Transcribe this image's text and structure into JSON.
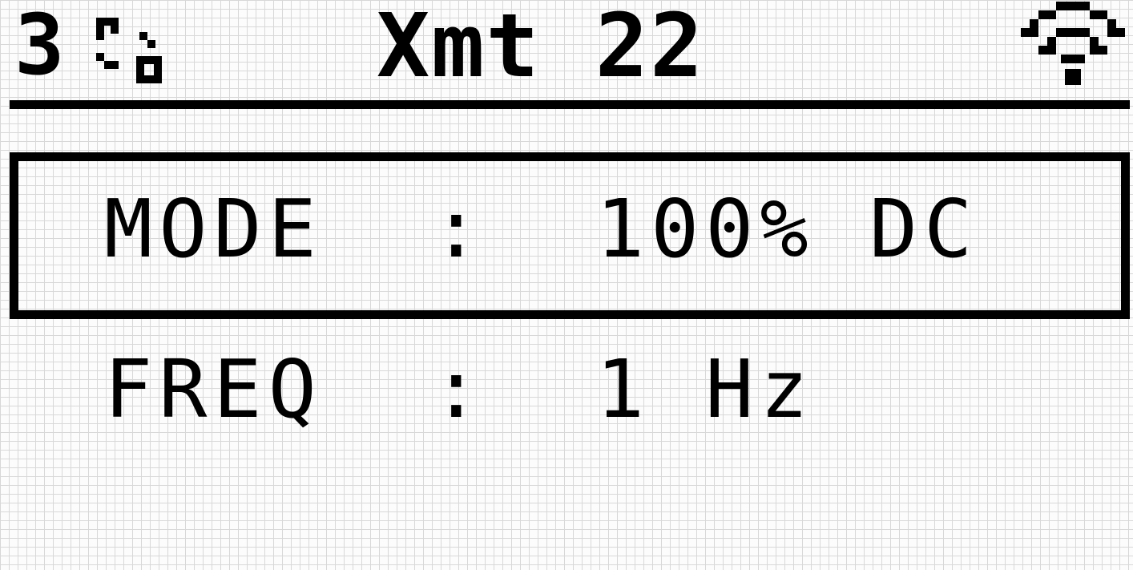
{
  "status_bar": {
    "slot_number": "3",
    "link_icon": "link-status-icon",
    "title": "Xmt 22",
    "signal_icon": "wifi-signal-icon"
  },
  "menu": {
    "selected_index": 0,
    "items": [
      {
        "label": "MODE",
        "separator": ":",
        "value": "100% DC"
      },
      {
        "label": "FREQ",
        "separator": ":",
        "value": "1 Hz"
      }
    ]
  },
  "colors": {
    "foreground": "#000000",
    "background": "#fcfcfc",
    "grid": "#d8d8d8"
  }
}
